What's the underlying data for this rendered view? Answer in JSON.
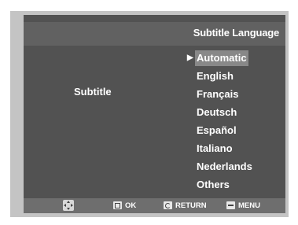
{
  "header": {
    "title": "Subtitle Language"
  },
  "left_label": "Subtitle",
  "menu": {
    "cursor": "▶",
    "items": [
      {
        "label": "Automatic",
        "selected": true
      },
      {
        "label": "English"
      },
      {
        "label": "Français"
      },
      {
        "label": "Deutsch"
      },
      {
        "label": "Español"
      },
      {
        "label": "Italiano"
      },
      {
        "label": "Nederlands"
      },
      {
        "label": "Others"
      }
    ]
  },
  "footer": {
    "ok_label": "OK",
    "return_label": "RETURN",
    "menu_label": "MENU"
  },
  "colors": {
    "screen_bg": "#525252",
    "title_bar_bg": "#616161",
    "footer_bg": "#6e6e6e",
    "selection_bg": "#888888",
    "text": "#ffffff"
  }
}
